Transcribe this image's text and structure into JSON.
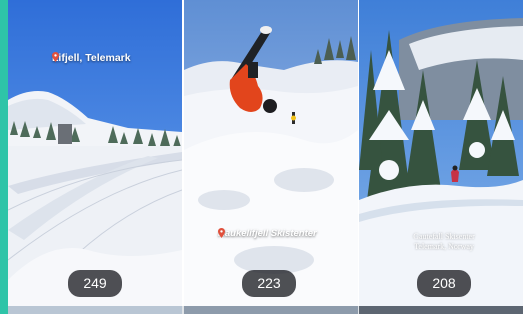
{
  "feed": {
    "tiles": [
      {
        "location": "Lifjell, Telemark",
        "views": "249",
        "pin_icon": "location-pin-icon"
      },
      {
        "location": "Haukelifjell Skistenter",
        "views": "223",
        "pin_icon": "location-pin-icon"
      },
      {
        "caption_line1": "Gautefall Skisenter",
        "caption_line2": "Telemark, Norway",
        "views": "208"
      }
    ]
  },
  "colors": {
    "accent_strip": "#2ec4a8",
    "pin": "#e0503c",
    "badge_bg": "#2a2c30"
  }
}
